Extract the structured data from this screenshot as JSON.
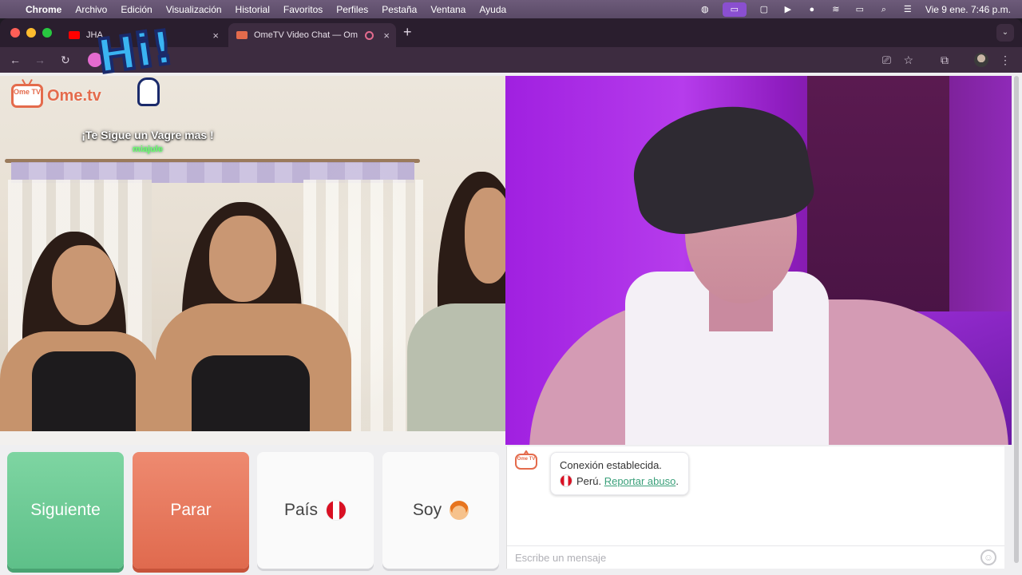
{
  "menubar": {
    "items": [
      "Chrome",
      "Archivo",
      "Edición",
      "Visualización",
      "Historial",
      "Favoritos",
      "Perfiles",
      "Pestaña",
      "Ventana",
      "Ayuda"
    ],
    "datetime": "Vie 9 ene.  7:46 p.m."
  },
  "tabs": [
    {
      "title": "JHA",
      "close": "×"
    },
    {
      "title": "OmeTV Video Chat — Om",
      "close": "×"
    }
  ],
  "tabbar": {
    "new_tab": "+"
  },
  "toolbar": {
    "back": "←",
    "forward": "→",
    "reload": "↻"
  },
  "left_video": {
    "logo_badge": "Ome TV",
    "logo_text": "Ome.tv",
    "sticker_text": "Hi!",
    "follow_text": "¡Te Sigue un Vagre mas !",
    "follow_user": "miajule"
  },
  "controls": {
    "next_label": "Siguiente",
    "stop_label": "Parar",
    "country_label": "País",
    "gender_label": "Soy"
  },
  "chat": {
    "logo_badge": "Ome TV",
    "message_line1": "Conexión establecida.",
    "country": "Perú.",
    "report_link": "Reportar abuso",
    "period": ".",
    "input_placeholder": "Escribe un mensaje"
  },
  "colors": {
    "next": "#6fcb96",
    "stop": "#e87a5e",
    "brand": "#e46b4c",
    "link": "#3aa07a"
  }
}
